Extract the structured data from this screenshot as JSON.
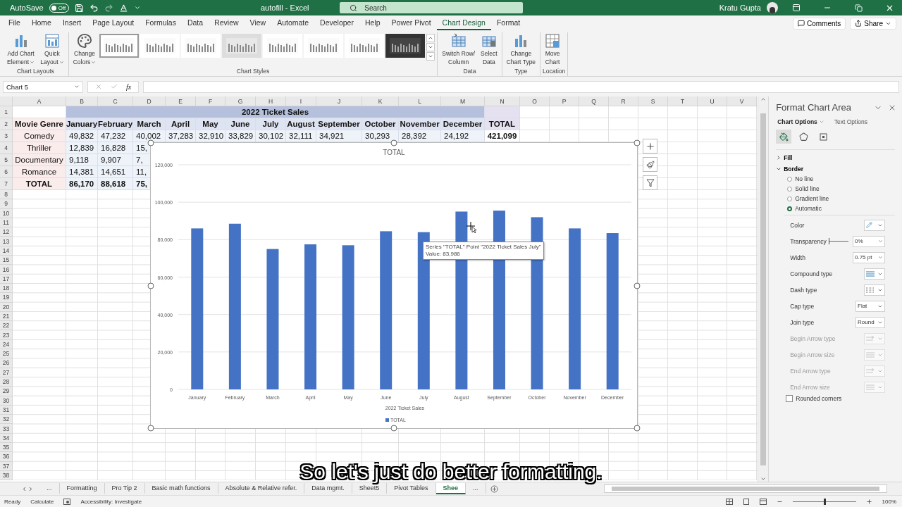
{
  "title_bar": {
    "autosave": {
      "label": "AutoSave",
      "on": false,
      "state_text": "Off"
    },
    "document": "autofill  -  Excel",
    "search": {
      "placeholder": "Search"
    },
    "user": "Kratu Gupta"
  },
  "menu_tabs": [
    {
      "label": "File",
      "selected": false
    },
    {
      "label": "Home",
      "selected": false
    },
    {
      "label": "Insert",
      "selected": false
    },
    {
      "label": "Page Layout",
      "selected": false
    },
    {
      "label": "Formulas",
      "selected": false
    },
    {
      "label": "Data",
      "selected": false
    },
    {
      "label": "Review",
      "selected": false
    },
    {
      "label": "View",
      "selected": false
    },
    {
      "label": "Automate",
      "selected": false
    },
    {
      "label": "Developer",
      "selected": false
    },
    {
      "label": "Help",
      "selected": false
    },
    {
      "label": "Power Pivot",
      "selected": false
    },
    {
      "label": "Chart Design",
      "selected": true
    },
    {
      "label": "Format",
      "selected": false
    }
  ],
  "actions": [
    "Comments",
    "Share"
  ],
  "ribbon": [
    {
      "name": "Chart Layouts",
      "buttons": [
        {
          "lines": [
            "Add Chart",
            "Element"
          ],
          "dropdown": true
        },
        {
          "lines": [
            "Quick",
            "Layout"
          ],
          "dropdown": true
        }
      ]
    },
    {
      "name": "Chart Styles",
      "buttons": [
        {
          "lines": [
            "Change",
            "Colors"
          ],
          "dropdown": true
        }
      ],
      "gallery": [
        {
          "dark": false,
          "shaded": false,
          "selected": true
        },
        {
          "dark": false,
          "shaded": false,
          "selected": false
        },
        {
          "dark": false,
          "shaded": false,
          "selected": false
        },
        {
          "dark": false,
          "shaded": true,
          "selected": false
        },
        {
          "dark": false,
          "shaded": false,
          "selected": false
        },
        {
          "dark": false,
          "shaded": false,
          "selected": false
        },
        {
          "dark": false,
          "shaded": false,
          "selected": false
        },
        {
          "dark": true,
          "shaded": false,
          "selected": false
        }
      ]
    },
    {
      "name": "Data",
      "buttons": [
        {
          "lines": [
            "Switch Row/",
            "Column"
          ],
          "dropdown": false
        },
        {
          "lines": [
            "Select",
            "Data"
          ],
          "dropdown": false
        }
      ]
    },
    {
      "name": "Type",
      "buttons": [
        {
          "lines": [
            "Change",
            "Chart Type"
          ],
          "dropdown": false
        }
      ]
    },
    {
      "name": "Location",
      "buttons": [
        {
          "lines": [
            "Move",
            "Chart"
          ],
          "dropdown": false
        }
      ]
    }
  ],
  "name_box": "Chart 5",
  "function_label": "fx",
  "sheet": {
    "columns": [
      "A",
      "B",
      "C",
      "D",
      "E",
      "F",
      "G",
      "H",
      "I",
      "J",
      "K",
      "L",
      "M",
      "N",
      "O",
      "P",
      "Q",
      "R",
      "S",
      "T",
      "U",
      "V"
    ],
    "banner": "2022 Ticket Sales",
    "rows": [
      {
        "number": "1"
      },
      {
        "number": "2",
        "cells": [
          {
            "kind": "genre",
            "text": "Movie Genre",
            "bold": true
          },
          {
            "kind": "month",
            "text": "January",
            "bold": true
          },
          {
            "kind": "month",
            "text": "February",
            "bold": true
          },
          {
            "kind": "month",
            "text": "March",
            "bold": true
          },
          {
            "kind": "month",
            "text": "April",
            "bold": true
          },
          {
            "kind": "month",
            "text": "May",
            "bold": true
          },
          {
            "kind": "month",
            "text": "June",
            "bold": true
          },
          {
            "kind": "month",
            "text": "July",
            "bold": true
          },
          {
            "kind": "month",
            "text": "August",
            "bold": true
          },
          {
            "kind": "month",
            "text": "September",
            "bold": true
          },
          {
            "kind": "month",
            "text": "October",
            "bold": true
          },
          {
            "kind": "month",
            "text": "November",
            "bold": true
          },
          {
            "kind": "month",
            "text": "December",
            "bold": true
          },
          {
            "kind": "shade",
            "text": "TOTAL",
            "bold": true
          }
        ]
      },
      {
        "number": "3",
        "cells": [
          {
            "kind": "genre",
            "text": "Comedy",
            "bold": false
          },
          {
            "kind": "value",
            "text": "49,832",
            "bold": false
          },
          {
            "kind": "value",
            "text": "47,232",
            "bold": false
          },
          {
            "kind": "value",
            "text": "40,002",
            "bold": false
          },
          {
            "kind": "value",
            "text": "37,283",
            "bold": false
          },
          {
            "kind": "value",
            "text": "32,910",
            "bold": false
          },
          {
            "kind": "value",
            "text": "33,829",
            "bold": false
          },
          {
            "kind": "value",
            "text": "30,102",
            "bold": false
          },
          {
            "kind": "value",
            "text": "32,111",
            "bold": false
          },
          {
            "kind": "value",
            "text": "34,921",
            "bold": false
          },
          {
            "kind": "value",
            "text": "30,293",
            "bold": false
          },
          {
            "kind": "value",
            "text": "28,392",
            "bold": false
          },
          {
            "kind": "value",
            "text": "24,192",
            "bold": false
          },
          {
            "kind": "plain",
            "text": "421,099",
            "bold": true
          }
        ]
      },
      {
        "number": "4",
        "cells": [
          {
            "kind": "genre",
            "text": "Thriller",
            "bold": false
          },
          {
            "kind": "value",
            "text": "12,839",
            "bold": false
          },
          {
            "kind": "value",
            "text": "16,828",
            "bold": false
          },
          {
            "kind": "value",
            "text": "15,",
            "bold": false
          }
        ]
      },
      {
        "number": "5",
        "cells": [
          {
            "kind": "genre",
            "text": "Documentary",
            "bold": false
          },
          {
            "kind": "value",
            "text": "9,118",
            "bold": false
          },
          {
            "kind": "value",
            "text": "9,907",
            "bold": false
          },
          {
            "kind": "value",
            "text": "7,",
            "bold": false
          }
        ]
      },
      {
        "number": "6",
        "cells": [
          {
            "kind": "genre",
            "text": "Romance",
            "bold": false
          },
          {
            "kind": "value",
            "text": "14,381",
            "bold": false
          },
          {
            "kind": "value",
            "text": "14,651",
            "bold": false
          },
          {
            "kind": "value",
            "text": "11,",
            "bold": false
          }
        ]
      },
      {
        "number": "7",
        "cells": [
          {
            "kind": "genre",
            "text": "TOTAL",
            "bold": true
          },
          {
            "kind": "value",
            "text": "86,170",
            "bold": true
          },
          {
            "kind": "value",
            "text": "88,618",
            "bold": true
          },
          {
            "kind": "value",
            "text": "75,",
            "bold": true
          }
        ]
      }
    ],
    "empty_rows": [
      "8",
      "9",
      "10",
      "11",
      "12",
      "13",
      "14",
      "15",
      "16",
      "17",
      "18",
      "19",
      "20",
      "21",
      "22",
      "23",
      "24",
      "25",
      "26",
      "27",
      "28",
      "29",
      "30",
      "31",
      "32",
      "33",
      "34",
      "35",
      "36",
      "37",
      "38"
    ]
  },
  "chart": {
    "chart_data": {
      "type": "bar",
      "title": "TOTAL",
      "xlabel": "2022 Ticket Sales",
      "grid": true,
      "categories": [
        "January",
        "February",
        "March",
        "April",
        "May",
        "June",
        "July",
        "August",
        "September",
        "October",
        "November",
        "December"
      ],
      "series": [
        {
          "name": "TOTAL",
          "color": "#4472c4",
          "values": [
            86000,
            88500,
            75000,
            77500,
            77000,
            84500,
            84000,
            95000,
            95500,
            92000,
            86000,
            83500
          ]
        }
      ],
      "ylim": [
        0,
        120000
      ],
      "yticks": [
        {
          "value": 0,
          "label": "0"
        },
        {
          "value": 20000,
          "label": "20,000"
        },
        {
          "value": 40000,
          "label": "40,000"
        },
        {
          "value": 60000,
          "label": "60,000"
        },
        {
          "value": 80000,
          "label": "80,000"
        },
        {
          "value": 100000,
          "label": "100,000"
        },
        {
          "value": 120000,
          "label": "120,000"
        }
      ]
    },
    "tooltip": [
      "Series \"TOTAL\" Point \"2022 Ticket Sales July\"",
      "Value: 83,986"
    ]
  },
  "pane": {
    "title": "Format Chart Area",
    "option_tabs": [
      {
        "label": "Chart Options",
        "selected": true
      },
      {
        "label": "Text Options",
        "selected": false
      }
    ],
    "icon_tabs": [
      {
        "selected": true
      },
      {
        "selected": false
      },
      {
        "selected": false
      }
    ],
    "sections": [
      {
        "label": "Fill",
        "expanded": false
      },
      {
        "label": "Border",
        "expanded": true,
        "options": [
          {
            "label": "No line",
            "selected": false
          },
          {
            "label": "Solid line",
            "selected": false
          },
          {
            "label": "Gradient line",
            "selected": false
          },
          {
            "label": "Automatic",
            "selected": true
          }
        ],
        "properties": [
          {
            "label": "Color",
            "kind": "color",
            "disabled": false
          },
          {
            "label": "Transparency",
            "kind": "slider",
            "level": 0,
            "value": "0%",
            "disabled": false
          },
          {
            "label": "Width",
            "kind": "spin",
            "value": "0.75 pt",
            "disabled": false
          },
          {
            "label": "Compound type",
            "kind": "lines",
            "disabled": false
          },
          {
            "label": "Dash type",
            "kind": "dashes",
            "disabled": false
          },
          {
            "label": "Cap type",
            "kind": "select",
            "value": "Flat",
            "disabled": false
          },
          {
            "label": "Join type",
            "kind": "select",
            "value": "Round",
            "disabled": false
          },
          {
            "label": "Begin Arrow type",
            "kind": "arrows",
            "disabled": true
          },
          {
            "label": "Begin Arrow size",
            "kind": "lines",
            "disabled": true
          },
          {
            "label": "End Arrow type",
            "kind": "arrows",
            "disabled": true
          },
          {
            "label": "End Arrow size",
            "kind": "lines",
            "disabled": true
          }
        ],
        "rounded_corners": {
          "label": "Rounded corners",
          "checked": false
        }
      }
    ]
  },
  "sheet_tabs": {
    "leading": "...",
    "tabs": [
      {
        "label": "Formatting",
        "selected": false
      },
      {
        "label": "Pro Tip 2",
        "selected": false
      },
      {
        "label": "Basic math functions",
        "selected": false
      },
      {
        "label": "Absolute & Relative refer.",
        "selected": false
      },
      {
        "label": "Data mgmt.",
        "selected": false
      },
      {
        "label": "Sheet5",
        "selected": false
      },
      {
        "label": "Pivot Tables",
        "selected": false
      },
      {
        "label": "Shee",
        "selected": true
      }
    ],
    "trailing": "..."
  },
  "status_bar": {
    "items": [
      "Ready",
      "Calculate"
    ],
    "accessibility": "Accessibility: Investigate",
    "zoom": {
      "level": 0.5,
      "text": "100%"
    }
  },
  "caption": "So let's just do better formatting."
}
